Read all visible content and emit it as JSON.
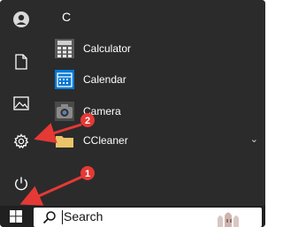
{
  "start_menu": {
    "section_letter": "C",
    "apps": [
      {
        "label": "Calculator",
        "icon": "calculator-icon"
      },
      {
        "label": "Calendar",
        "icon": "calendar-icon"
      },
      {
        "label": "Camera",
        "icon": "camera-icon"
      },
      {
        "label": "CCleaner",
        "icon": "folder-icon"
      }
    ],
    "rail_icons": [
      "user-icon",
      "document-icon",
      "pictures-icon",
      "settings-icon",
      "power-icon"
    ]
  },
  "taskbar": {
    "search_label": "Search"
  },
  "annotations": {
    "badges": [
      "1",
      "2"
    ],
    "color": "#e53935"
  },
  "colors": {
    "menu_bg": "#2b2b2b",
    "accent": "#0078d7"
  }
}
